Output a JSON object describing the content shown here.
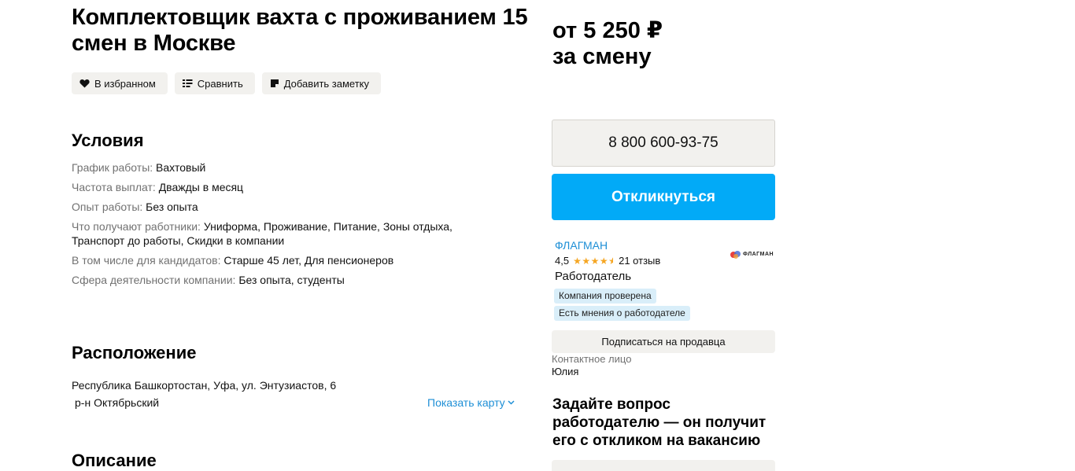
{
  "vacancy": {
    "title": "Комплектовщик вахта с проживанием 15 смен в Москве",
    "price_line1": "от 5 250 ₽",
    "price_line2": "за смену"
  },
  "actions": {
    "favorite": "В избранном",
    "compare": "Сравнить",
    "note": "Добавить заметку"
  },
  "conditions": {
    "heading": "Условия",
    "rows": [
      {
        "key": "График работы:",
        "value": "Вахтовый"
      },
      {
        "key": "Частота выплат:",
        "value": "Дважды в месяц"
      },
      {
        "key": "Опыт работы:",
        "value": "Без опыта"
      },
      {
        "key": "Что получают работники:",
        "value": "Униформа, Проживание, Питание, Зоны отдыха, Транспорт до работы, Скидки в компании"
      },
      {
        "key": "В том числе для кандидатов:",
        "value": "Старше 45 лет, Для пенсионеров"
      },
      {
        "key": "Сфера деятельности компании:",
        "value": "Без опыта, студенты"
      }
    ]
  },
  "location": {
    "heading": "Расположение",
    "address": "Республика Башкортостан, Уфа, ул. Энтузиастов, 6",
    "district": "р-н Октябрьский",
    "show_map": "Показать карту"
  },
  "description": {
    "heading": "Описание"
  },
  "sidebar": {
    "phone": "8 800 600-93-75",
    "respond_button": "Откликнуться",
    "company_name": "ФЛАГМАН",
    "rating": "4,5",
    "stars": 4.5,
    "reviews": "21 отзыв",
    "logo_text": "ФЛАГМАН",
    "employer_type": "Работодатель",
    "badge_verified": "Компания проверена",
    "badge_opinions": "Есть мнения о работодателе",
    "subscribe_button": "Подписаться на продавца",
    "contact_label": "Контактное лицо",
    "contact_name": "Юлия",
    "ask_heading": "Задайте вопрос работодателю — он получит его с откликом на вакансию"
  },
  "colors": {
    "accent_blue": "#02aaf7",
    "link_blue": "#1e8fd6",
    "chip_bg": "#f2f1ee",
    "badge_bg": "#d9eef9",
    "star": "#f5a623"
  }
}
